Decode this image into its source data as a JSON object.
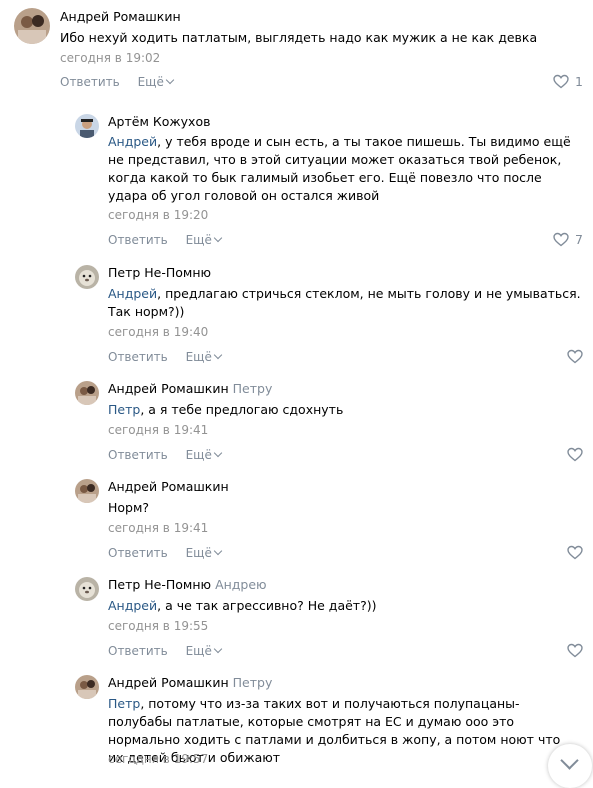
{
  "actions": {
    "reply": "Ответить",
    "more": "Ещё"
  },
  "comments": [
    {
      "author": "Андрей Ромашкин",
      "reply_to": "",
      "mention": "",
      "text": "Ибо нехуй ходить патлатым, выглядеть надо как мужик а не как девка",
      "time": "сегодня в 19:02",
      "likes": "1"
    },
    {
      "author": "Артём Кожухов",
      "reply_to": "",
      "mention": "Андрей",
      "text": ", у тебя вроде и сын есть, а ты такое пишешь. Ты видимо ещё не представил, что в этой ситуации может оказаться твой ребенок, когда какой то бык галимый изобьет его. Ещё повезло что после удара об угол головой он остался живой",
      "time": "сегодня в 19:20",
      "likes": "7"
    },
    {
      "author": "Петр Не-Помню",
      "reply_to": "",
      "mention": "Андрей",
      "text": ", предлагаю стричься стеклом, не мыть голову и не умываться. Так норм?))",
      "time": "сегодня в 19:40",
      "likes": ""
    },
    {
      "author": "Андрей Ромашкин",
      "reply_to": "Петру",
      "mention": "Петр",
      "text": ", а я тебе предлогаю сдохнуть",
      "time": "сегодня в 19:41",
      "likes": ""
    },
    {
      "author": "Андрей Ромашкин",
      "reply_to": "",
      "mention": "",
      "text": "Норм?",
      "time": "сегодня в 19:41",
      "likes": ""
    },
    {
      "author": "Петр Не-Помню",
      "reply_to": "Андрею",
      "mention": "Андрей",
      "text": ", а че так агрессивно? Не даёт?))",
      "time": "сегодня в 19:55",
      "likes": ""
    },
    {
      "author": "Андрей Ромашкин",
      "reply_to": "Петру",
      "mention": "Петр",
      "text": ", потому что из-за таких вот и получаються полупацаны-полубабы патлатые, которые смотрят на ЕС и думаю ооо это нормально ходить с патлами и долбиться в жопу, а потом ноют что их детей бьют и обижают",
      "time": "сегодня в 19:57",
      "likes": ""
    }
  ]
}
